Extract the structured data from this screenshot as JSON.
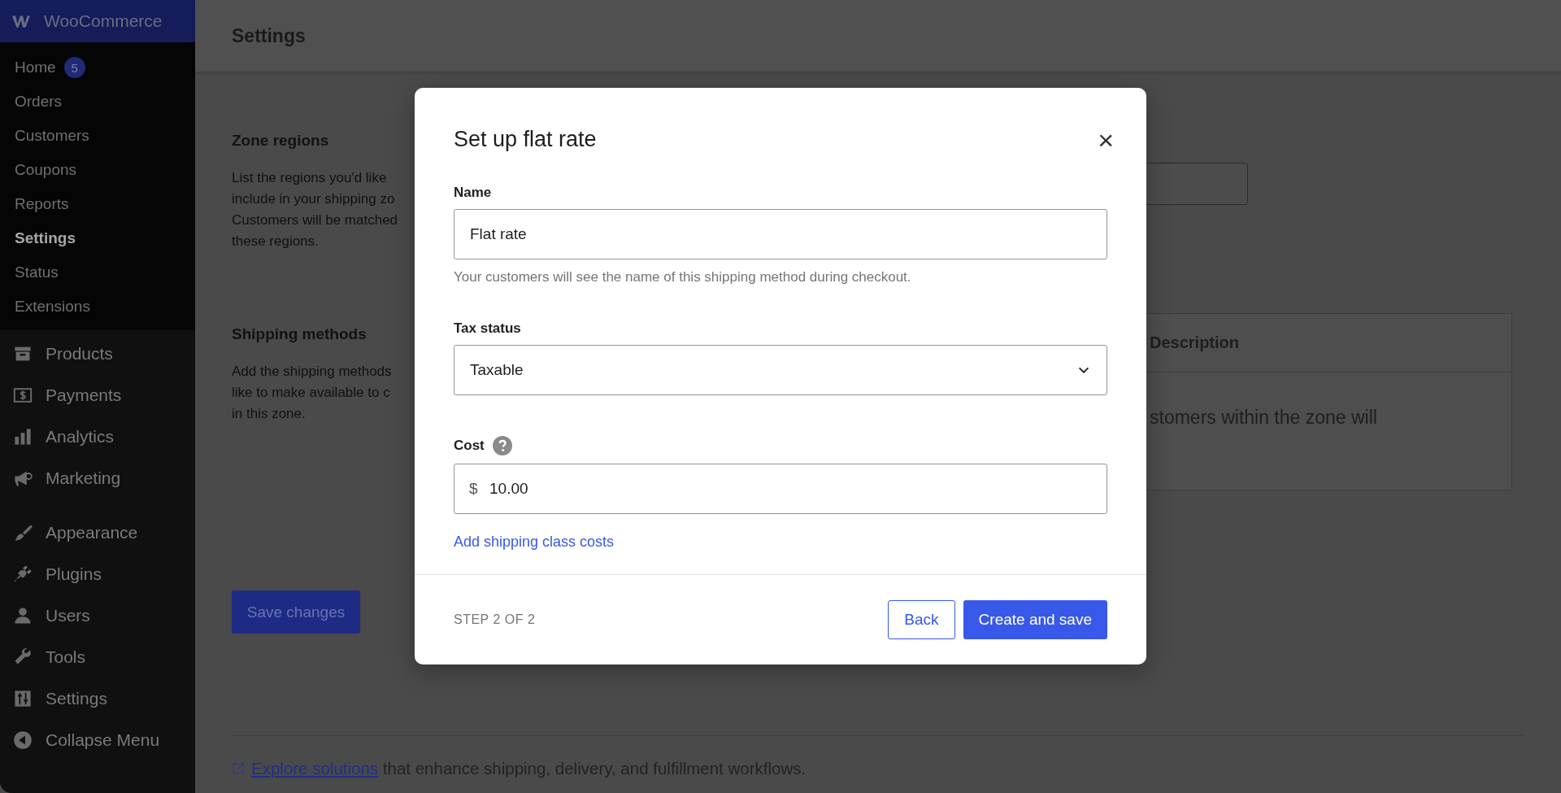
{
  "sidebar": {
    "brand": "WooCommerce",
    "submenu": [
      {
        "label": "Home",
        "badge": "5",
        "selected": false
      },
      {
        "label": "Orders",
        "selected": false
      },
      {
        "label": "Customers",
        "selected": false
      },
      {
        "label": "Coupons",
        "selected": false
      },
      {
        "label": "Reports",
        "selected": false
      },
      {
        "label": "Settings",
        "selected": true
      },
      {
        "label": "Status",
        "selected": false
      },
      {
        "label": "Extensions",
        "selected": false
      }
    ],
    "menu_groups": [
      [
        {
          "label": "Products",
          "kind": "products"
        },
        {
          "label": "Payments",
          "kind": "payments"
        },
        {
          "label": "Analytics",
          "kind": "analytics"
        },
        {
          "label": "Marketing",
          "kind": "marketing"
        }
      ],
      [
        {
          "label": "Appearance",
          "kind": "appearance"
        },
        {
          "label": "Plugins",
          "kind": "plugins"
        },
        {
          "label": "Users",
          "kind": "users"
        },
        {
          "label": "Tools",
          "kind": "tools"
        },
        {
          "label": "Settings",
          "kind": "settings"
        },
        {
          "label": "Collapse Menu",
          "kind": "collapse"
        }
      ]
    ]
  },
  "header": {
    "title": "Settings"
  },
  "sections": [
    {
      "title": "Zone regions",
      "lines": [
        "List the regions you'd like",
        "include in your shipping zo",
        "Customers will be matched",
        "these regions."
      ]
    },
    {
      "title": "Shipping methods",
      "lines": [
        "Add the shipping methods",
        "like to make available to c",
        "in this zone."
      ]
    }
  ],
  "methods_table": {
    "columns": [
      "Description"
    ],
    "rows": [
      [
        "stomers within the zone will"
      ]
    ]
  },
  "save_button": "Save changes",
  "footer": {
    "link": "Explore solutions",
    "text": " that enhance shipping, delivery, and fulfillment workflows."
  },
  "modal": {
    "title": "Set up flat rate",
    "close": "×",
    "name_label": "Name",
    "name_value": "Flat rate",
    "name_help": "Your customers will see the name of this shipping method during checkout.",
    "tax_label": "Tax status",
    "tax_value": "Taxable",
    "cost_label": "Cost",
    "cost_prefix": "$",
    "cost_value": "10.00",
    "class_costs_link": "Add shipping class costs",
    "step": "STEP 2 OF 2",
    "back_button": "Back",
    "primary_button": "Create and save"
  }
}
